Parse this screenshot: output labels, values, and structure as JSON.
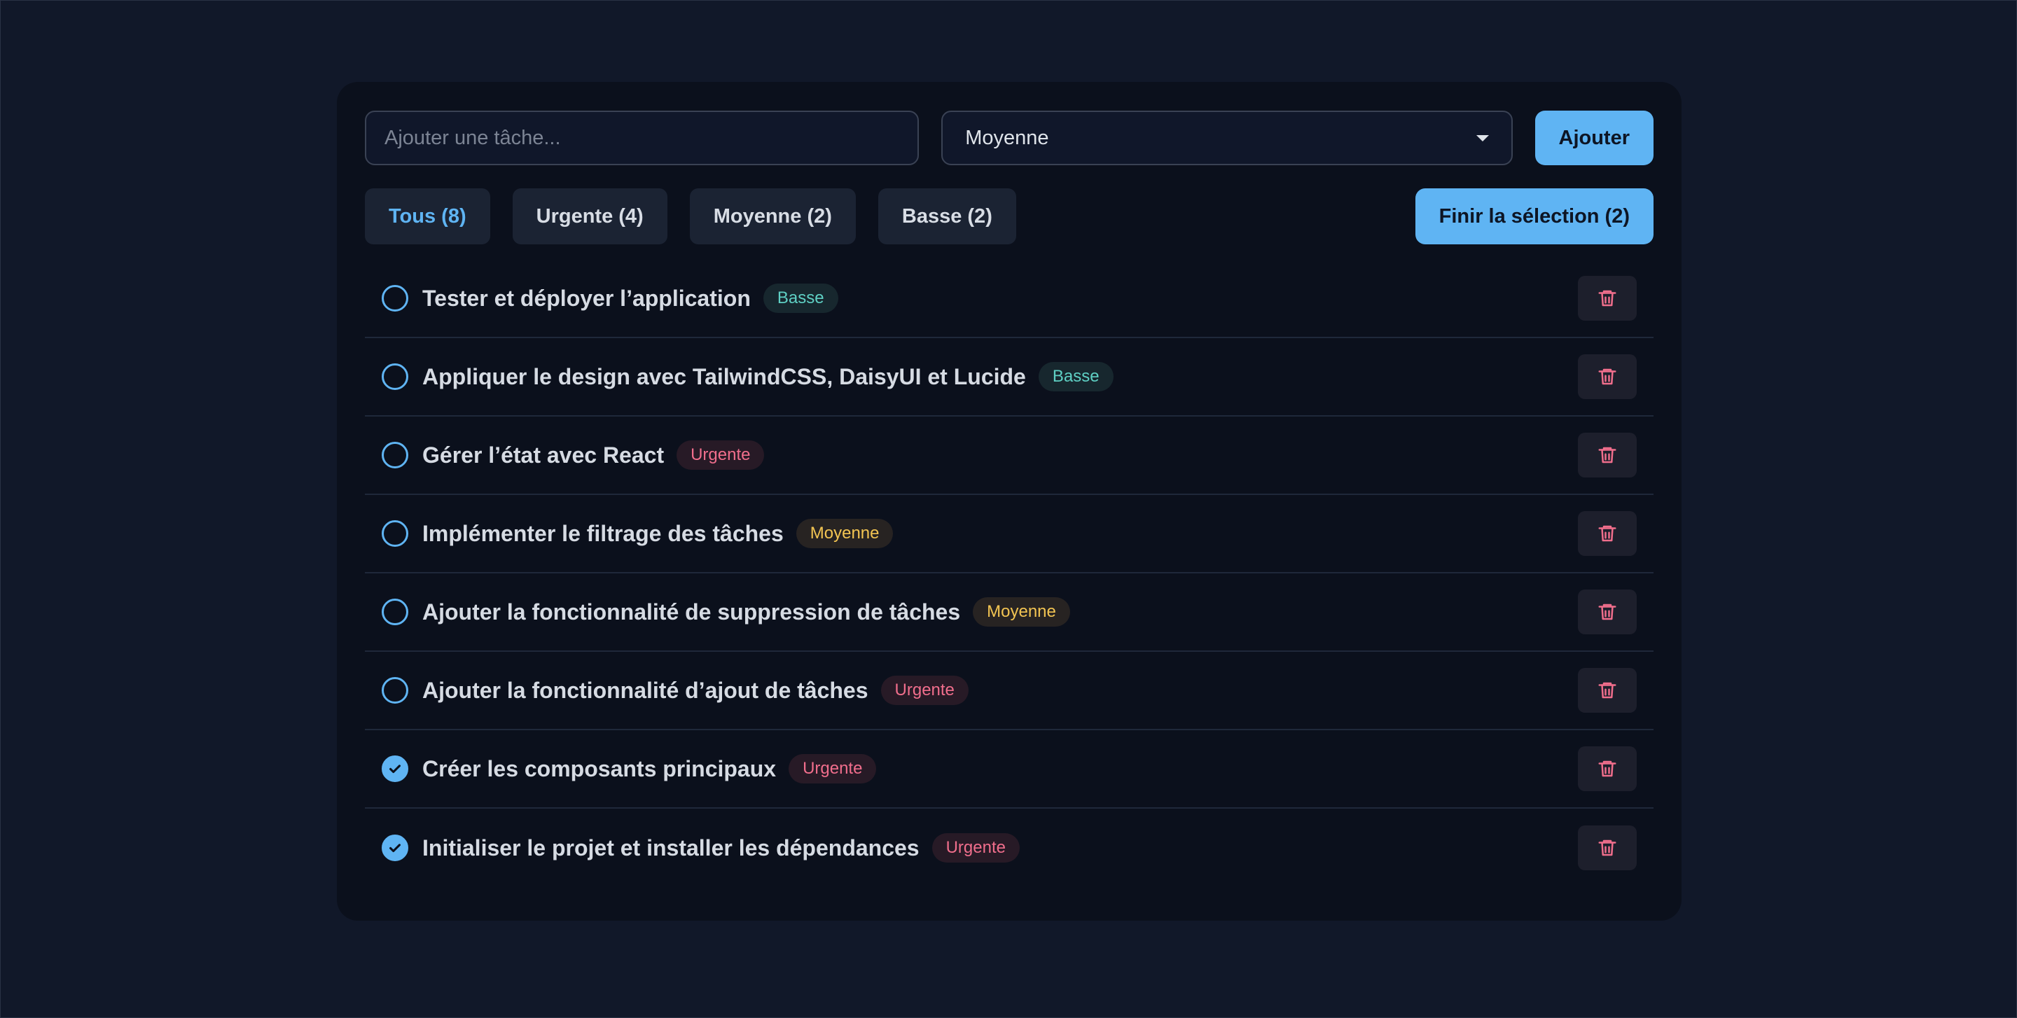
{
  "form": {
    "input_placeholder": "Ajouter une tâche...",
    "input_value": "",
    "priority_selected": "Moyenne",
    "add_label": "Ajouter"
  },
  "filters": {
    "all": "Tous (8)",
    "urgent": "Urgente (4)",
    "medium": "Moyenne (2)",
    "low": "Basse (2)",
    "active": "all"
  },
  "finish_label": "Finir la sélection (2)",
  "tasks": [
    {
      "title": "Tester et déployer l’application",
      "priority": "Basse",
      "done": false
    },
    {
      "title": "Appliquer le design avec TailwindCSS, DaisyUI et Lucide",
      "priority": "Basse",
      "done": false
    },
    {
      "title": "Gérer l’état avec React",
      "priority": "Urgente",
      "done": false
    },
    {
      "title": "Implémenter le filtrage des tâches",
      "priority": "Moyenne",
      "done": false
    },
    {
      "title": "Ajouter la fonctionnalité de suppression de tâches",
      "priority": "Moyenne",
      "done": false
    },
    {
      "title": "Ajouter la fonctionnalité d’ajout de tâches",
      "priority": "Urgente",
      "done": false
    },
    {
      "title": "Créer les composants principaux",
      "priority": "Urgente",
      "done": true
    },
    {
      "title": "Initialiser le projet et installer les dépendances",
      "priority": "Urgente",
      "done": true
    }
  ],
  "icons": {
    "checkbox": "circle-icon",
    "checked": "check-circle-icon",
    "delete": "trash-icon",
    "select": "chevron-down-icon"
  },
  "colors": {
    "accent": "#5fb4f3",
    "urgent": "#f06e8c",
    "medium": "#f2c452",
    "low": "#5fd0c4"
  }
}
